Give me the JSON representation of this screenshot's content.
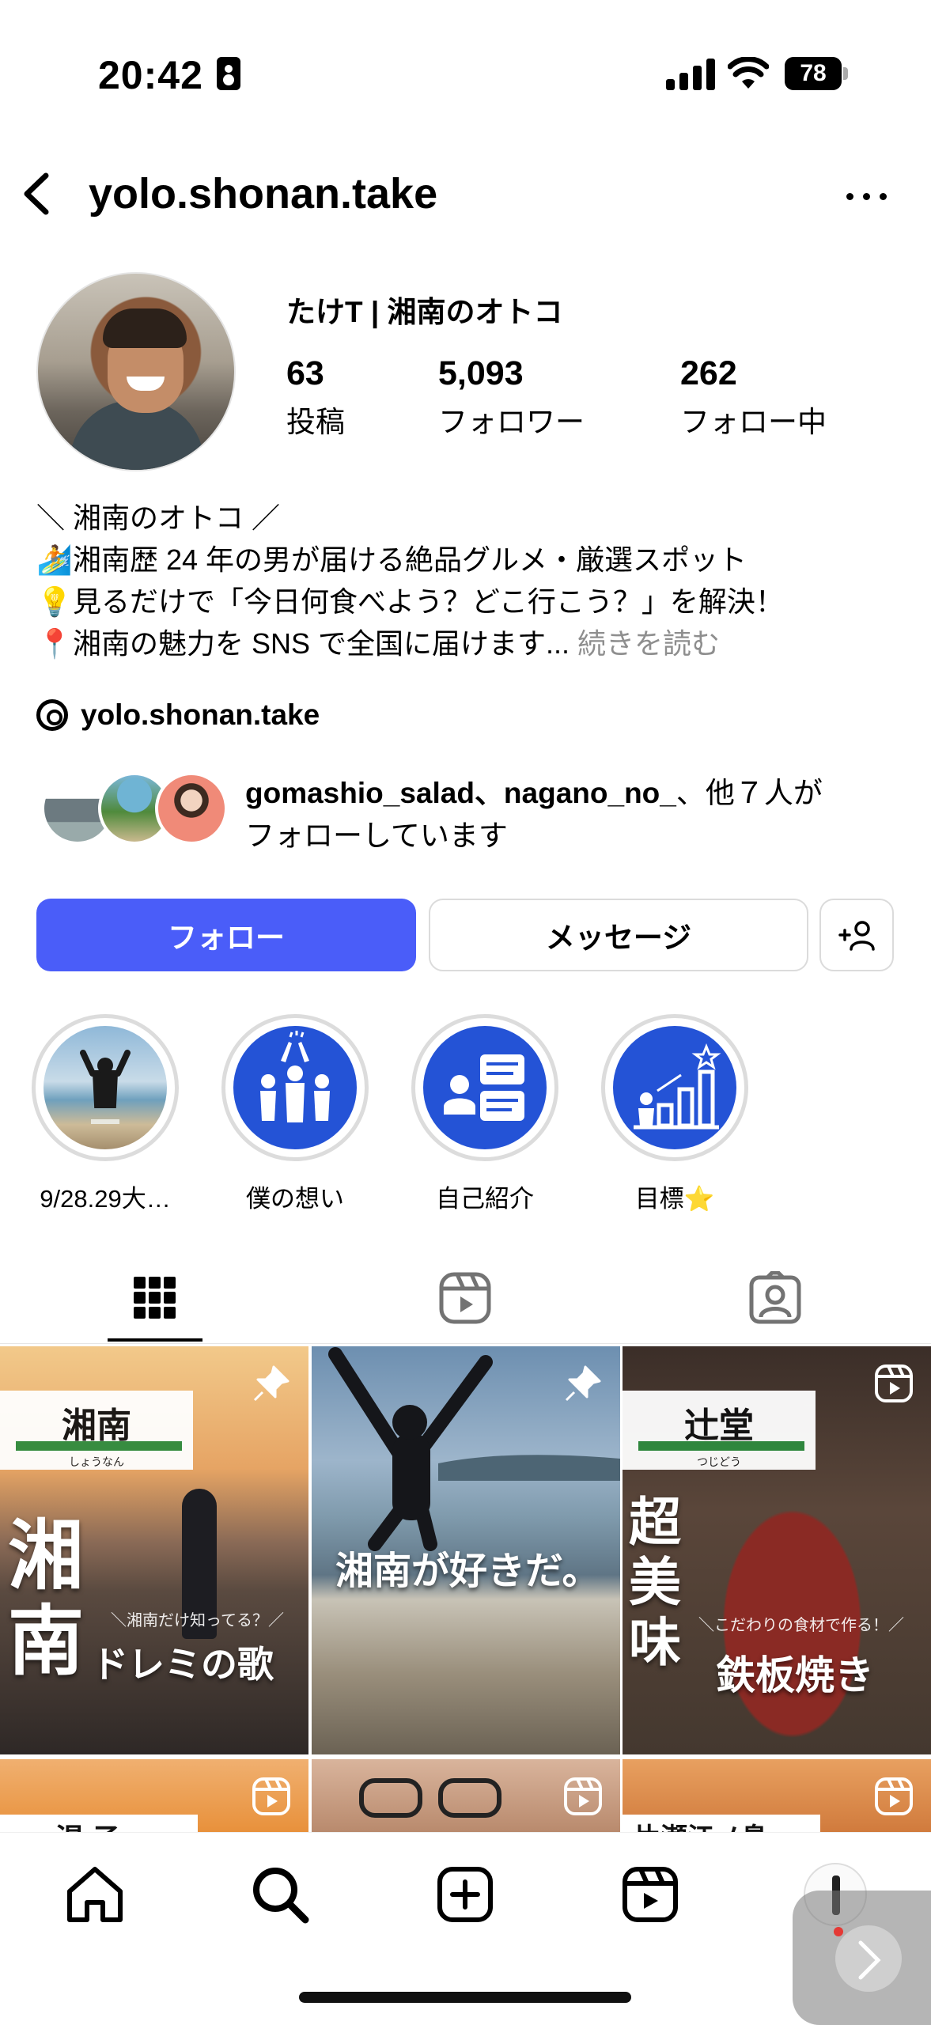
{
  "status_bar": {
    "time": "20:42",
    "battery": "78"
  },
  "header": {
    "username": "yolo.shonan.take"
  },
  "profile": {
    "display_name": "たけT | 湘南のオトコ",
    "stats": [
      {
        "value": "63",
        "label": "投稿"
      },
      {
        "value": "5,093",
        "label": "フォロワー"
      },
      {
        "value": "262",
        "label": "フォロー中"
      }
    ],
    "bio": {
      "line1": "＼ 湘南のオトコ ／",
      "line2": "湘南歴 24 年の男が届ける絶品グルメ・厳選スポット",
      "line3": "見るだけで「今日何食べよう？どこ行こう？」を解決！",
      "line4": "湘南の魅力を SNS で全国に届けます...",
      "more": " 続きを読む"
    },
    "threads_handle": "yolo.shonan.take",
    "followed_by": {
      "names": "gomashio_salad、nagano_no_",
      "rest": "、他７人が",
      "line2": "フォローしています"
    }
  },
  "buttons": {
    "follow": "フォロー",
    "message": "メッセージ"
  },
  "highlights": [
    {
      "label": "9/28.29大…"
    },
    {
      "label": "僕の想い"
    },
    {
      "label": "自己紹介"
    },
    {
      "label": "目標⭐"
    }
  ],
  "posts": [
    {
      "sign": "湘南",
      "kana": "しょうなん",
      "big": "湘南",
      "text": "ドレミの歌",
      "sub": "＼湘南だけ知ってる？／"
    },
    {
      "text": "湘南が好きだ。"
    },
    {
      "sign": "辻堂",
      "kana": "つじどう",
      "big": "超美味",
      "text": "鉄板焼き",
      "sub": "＼こだわりの食材で作る！／"
    },
    {
      "partial": "湯 子"
    },
    {
      "partial": ""
    },
    {
      "partial": "片瀬江ノ島"
    }
  ],
  "colors": {
    "accent": "#4a5df9",
    "highlight_blue": "#2453d6",
    "muted": "#8e8e8e"
  }
}
